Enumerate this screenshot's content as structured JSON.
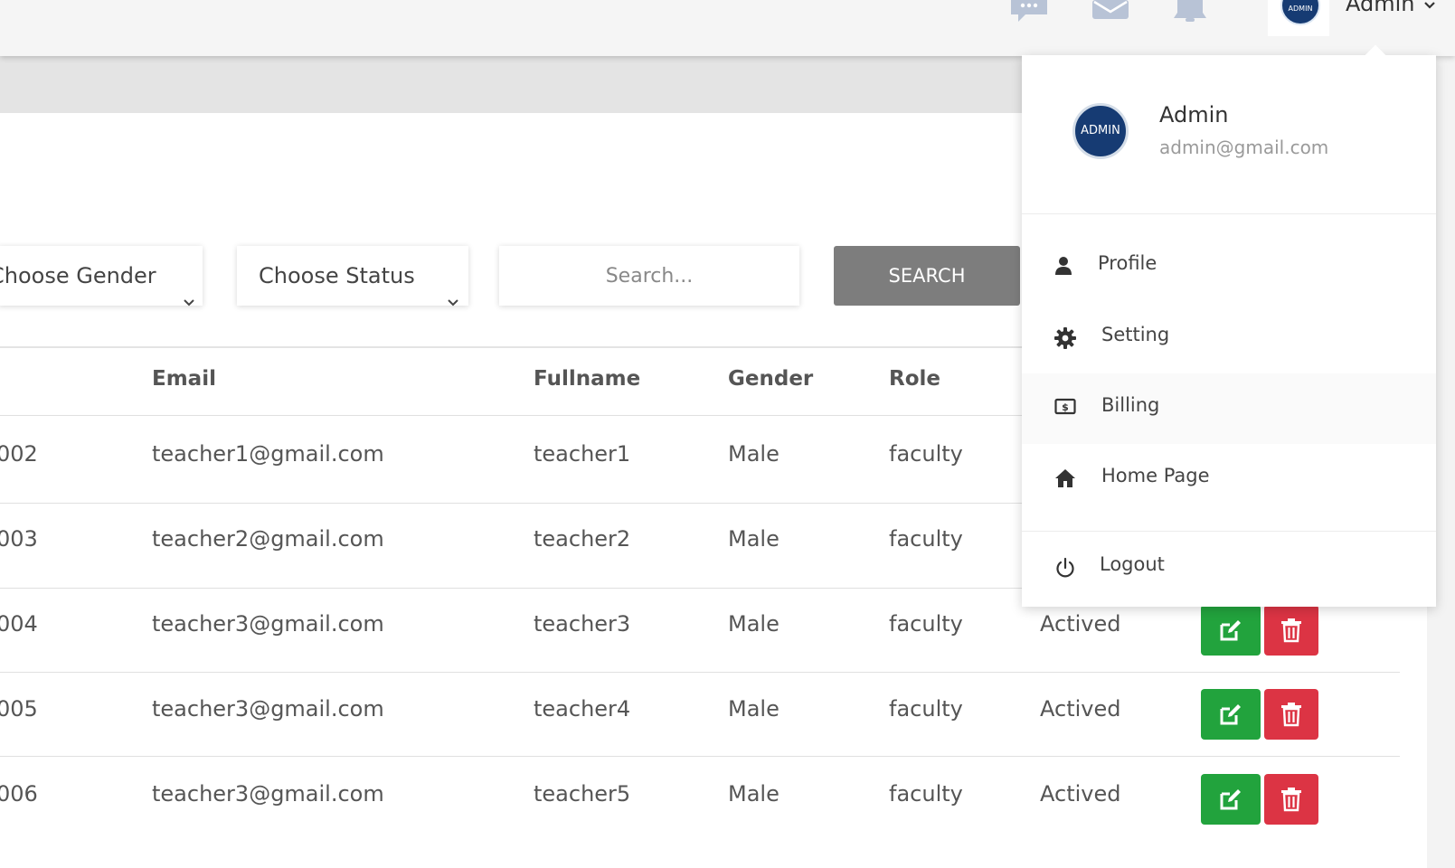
{
  "header": {
    "user_name": "Admin",
    "avatar_text": "ADMIN",
    "icons": [
      "chat-icon",
      "mail-icon",
      "bell-icon",
      "chevron-down-icon"
    ]
  },
  "filters": {
    "gender": {
      "selected": "Choose Gender"
    },
    "status": {
      "selected": "Choose Status"
    },
    "search_placeholder": "Search...",
    "search_button": "SEARCH"
  },
  "table": {
    "columns": [
      "Email",
      "Fullname",
      "Gender",
      "Role"
    ],
    "rows": [
      {
        "id": "002",
        "email": "teacher1@gmail.com",
        "fullname": "teacher1",
        "gender": "Male",
        "role": "faculty",
        "status": ""
      },
      {
        "id": "003",
        "email": "teacher2@gmail.com",
        "fullname": "teacher2",
        "gender": "Male",
        "role": "faculty",
        "status": ""
      },
      {
        "id": "004",
        "email": "teacher3@gmail.com",
        "fullname": "teacher3",
        "gender": "Male",
        "role": "faculty",
        "status": "Actived"
      },
      {
        "id": "005",
        "email": "teacher3@gmail.com",
        "fullname": "teacher4",
        "gender": "Male",
        "role": "faculty",
        "status": "Actived"
      },
      {
        "id": "006",
        "email": "teacher3@gmail.com",
        "fullname": "teacher5",
        "gender": "Male",
        "role": "faculty",
        "status": "Actived"
      }
    ]
  },
  "dropdown": {
    "avatar_text": "ADMIN",
    "name": "Admin",
    "email": "admin@gmail.com",
    "items": [
      {
        "label": "Profile",
        "icon": "person-icon"
      },
      {
        "label": "Setting",
        "icon": "gear-icon"
      },
      {
        "label": "Billing",
        "icon": "billing-icon"
      },
      {
        "label": "Home Page",
        "icon": "home-icon"
      },
      {
        "label": "Logout",
        "icon": "power-icon"
      }
    ]
  },
  "colors": {
    "edit_button": "#22a33d",
    "delete_button": "#dc3444",
    "search_button": "#7d7d7d",
    "avatar": "#163b73",
    "header_icons": "#b8c3d6"
  }
}
